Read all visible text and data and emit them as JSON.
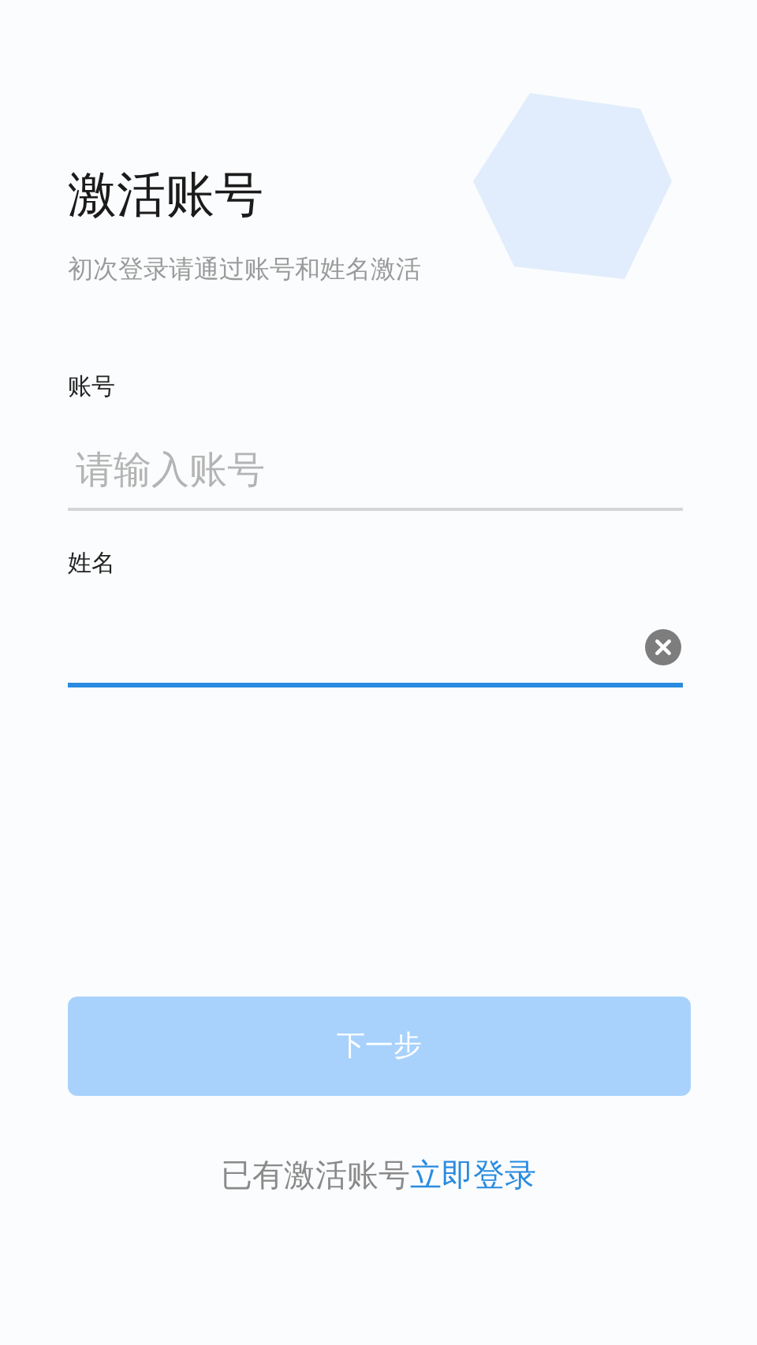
{
  "title": "激活账号",
  "subtitle": "初次登录请通过账号和姓名激活",
  "fields": [
    {
      "label": "账号",
      "placeholder": "请输入账号",
      "focused": false
    },
    {
      "label": "姓名",
      "focused": true
    }
  ],
  "next_button": {
    "label": "下一步",
    "disabled": true
  },
  "footer": {
    "text": "已有激活账号",
    "link": "立即登录"
  }
}
